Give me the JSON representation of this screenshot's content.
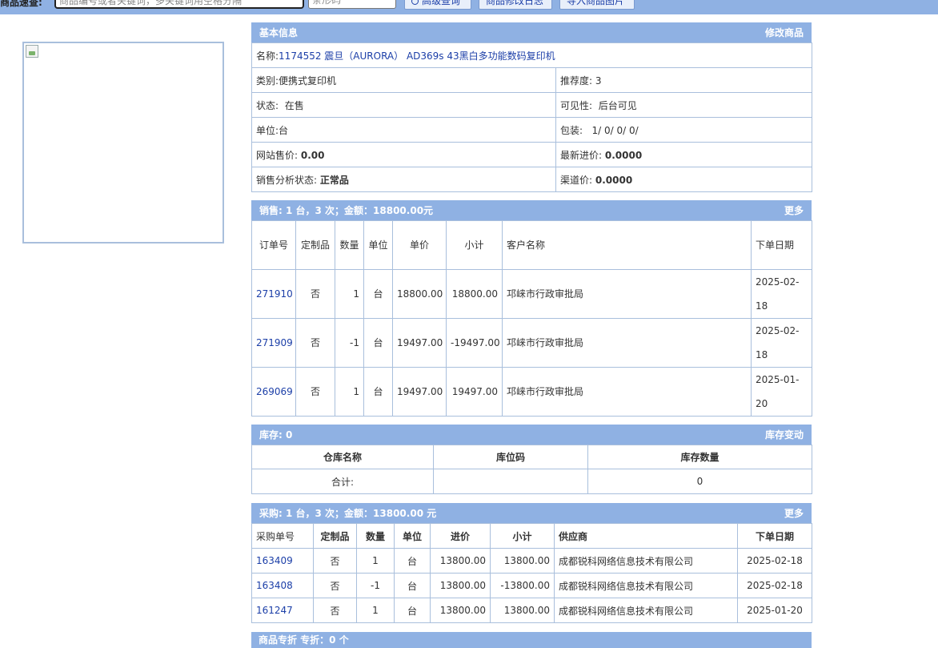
{
  "topbar": {
    "label": "商品速查:",
    "search_placeholder": "商品编号或者关键词，多关键词用空格分隔",
    "barcode_placeholder": "条形码",
    "advanced_search": "高级查询",
    "change_log": "商品修改日志",
    "import_images": "导入商品图片"
  },
  "basic": {
    "header": "基本信息",
    "edit": "修改商品",
    "name_label": "名称:",
    "name_value": "1174552 震旦（AURORA） AD369s 43黑白多功能数码复印机",
    "category_label": "类别:",
    "category_value": "便携式复印机",
    "recommend_label": "推荐度:",
    "recommend_value": "3",
    "status_label": "状态:",
    "status_value": "在售",
    "visibility_label": "可见性:",
    "visibility_value": "后台可见",
    "unit_label": "单位:",
    "unit_value": "台",
    "package_label": "包装:",
    "package_value": "1/ 0/ 0/ 0/",
    "web_price_label": "网站售价:",
    "web_price_value": "0.00",
    "latest_cost_label": "最新进价:",
    "latest_cost_value": "0.0000",
    "sales_status_label": "销售分析状态:",
    "sales_status_value": "正常品",
    "channel_price_label": "渠道价:",
    "channel_price_value": "0.0000"
  },
  "sales": {
    "header": "销售:  1 台，3 次；金额：18800.00元",
    "more": "更多",
    "columns": [
      "订单号",
      "定制品",
      "数量",
      "单位",
      "单价",
      "小计",
      "客户名称",
      "下单日期"
    ],
    "rows": [
      {
        "order": "271910",
        "custom": "否",
        "qty": "1",
        "unit": "台",
        "price": "18800.00",
        "subtotal": "18800.00",
        "customer": "邛崃市行政审批局",
        "date": "2025-02-18"
      },
      {
        "order": "271909",
        "custom": "否",
        "qty": "-1",
        "unit": "台",
        "price": "19497.00",
        "subtotal": "-19497.00",
        "customer": "邛崃市行政审批局",
        "date": "2025-02-18"
      },
      {
        "order": "269069",
        "custom": "否",
        "qty": "1",
        "unit": "台",
        "price": "19497.00",
        "subtotal": "19497.00",
        "customer": "邛崃市行政审批局",
        "date": "2025-01-20"
      }
    ]
  },
  "stock": {
    "header": "库存:  0",
    "change": "库存变动",
    "columns": [
      "仓库名称",
      "库位码",
      "库存数量"
    ],
    "total_label": "合计:",
    "total_value": "0"
  },
  "purchase": {
    "header": "采购:  1 台，3 次；金额：13800.00 元",
    "more": "更多",
    "columns": [
      "采购单号",
      "定制品",
      "数量",
      "单位",
      "进价",
      "小计",
      "供应商",
      "下单日期"
    ],
    "rows": [
      {
        "order": "163409",
        "custom": "否",
        "qty": "1",
        "unit": "台",
        "price": "13800.00",
        "subtotal": "13800.00",
        "supplier": "成都锐科网络信息技术有限公司",
        "date": "2025-02-18"
      },
      {
        "order": "163408",
        "custom": "否",
        "qty": "-1",
        "unit": "台",
        "price": "13800.00",
        "subtotal": "-13800.00",
        "supplier": "成都锐科网络信息技术有限公司",
        "date": "2025-02-18"
      },
      {
        "order": "161247",
        "custom": "否",
        "qty": "1",
        "unit": "台",
        "price": "13800.00",
        "subtotal": "13800.00",
        "supplier": "成都锐科网络信息技术有限公司",
        "date": "2025-01-20"
      }
    ]
  },
  "next_panel": {
    "header": "商品专折  专折：0 个"
  }
}
